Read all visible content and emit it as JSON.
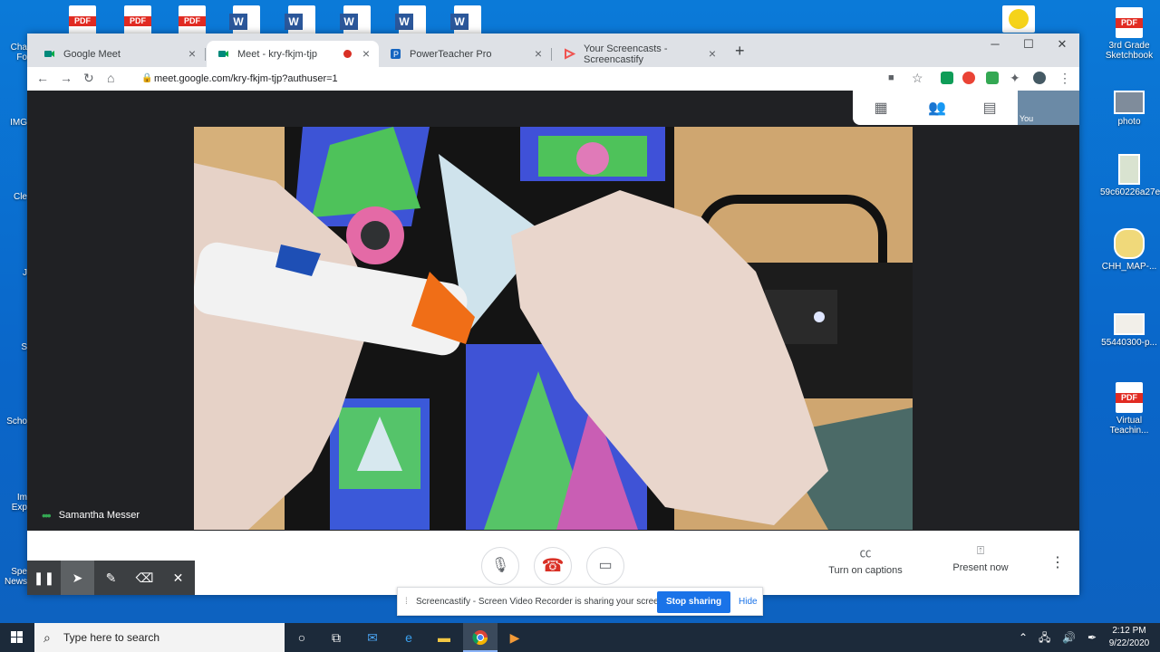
{
  "desktop": {
    "top_icons": [
      "PDF",
      "PDF",
      "PDF",
      "W",
      "W",
      "W",
      "W",
      "W"
    ],
    "left_labels": [
      "Cha Fo",
      "IMG",
      "Cle",
      "J",
      "S",
      "Scho",
      "Im Exp",
      "Spe News"
    ],
    "right_icons": [
      {
        "label": "3rd Grade Sketchbook",
        "type": "pdf"
      },
      {
        "label": "photo",
        "type": "img"
      },
      {
        "label": "59c60226a27e",
        "type": "img"
      },
      {
        "label": "CHH_MAP-...",
        "type": "img"
      },
      {
        "label": "55440300-p...",
        "type": "img"
      },
      {
        "label": "Virtual Teachin...",
        "type": "pdf"
      }
    ],
    "pdf_text": "PDF",
    "word_text": "W"
  },
  "browser": {
    "tabs": [
      {
        "title": "Google Meet"
      },
      {
        "title": "Meet - kry-fkjm-tjp"
      },
      {
        "title": "PowerTeacher Pro"
      },
      {
        "title": "Your Screencasts - Screencastify"
      }
    ],
    "new_tab": "+",
    "url": "meet.google.com/kry-fkjm-tjp?authuser=1"
  },
  "meet": {
    "speaker_name": "Samantha Messer",
    "self_label": "You",
    "captions_label": "Turn on captions",
    "present_label": "Present now"
  },
  "screencastify": {
    "notice": "Screencastify - Screen Video Recorder is sharing your screen.",
    "stop_label": "Stop sharing",
    "hide_label": "Hide"
  },
  "taskbar": {
    "search_placeholder": "Type here to search",
    "time": "2:12 PM",
    "date": "9/22/2020"
  },
  "colors": {
    "desktop_blue": "#0a6fd6",
    "meet_bg": "#202124",
    "hangup_red": "#d93025",
    "accent_blue": "#1a73e8"
  }
}
